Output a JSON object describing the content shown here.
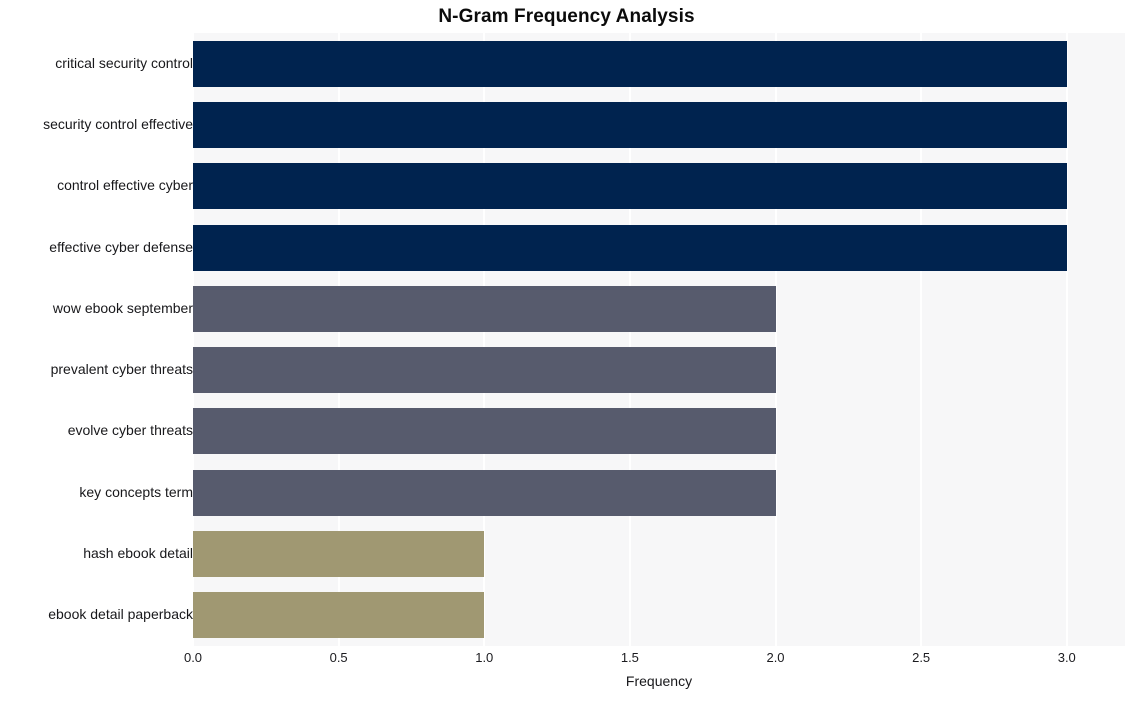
{
  "chart_data": {
    "type": "bar",
    "orientation": "horizontal",
    "title": "N-Gram Frequency Analysis",
    "xlabel": "Frequency",
    "ylabel": "",
    "categories": [
      "critical security control",
      "security control effective",
      "control effective cyber",
      "effective cyber defense",
      "wow ebook september",
      "prevalent cyber threats",
      "evolve cyber threats",
      "key concepts term",
      "hash ebook detail",
      "ebook detail paperback"
    ],
    "values": [
      3,
      3,
      3,
      3,
      2,
      2,
      2,
      2,
      1,
      1
    ],
    "bar_colors": [
      "#00234f",
      "#00234f",
      "#00234f",
      "#00234f",
      "#575b6d",
      "#575b6d",
      "#575b6d",
      "#575b6d",
      "#a09872",
      "#a09872"
    ],
    "xlim": [
      0.0,
      3.2
    ],
    "xticks": [
      "0.0",
      "0.5",
      "1.0",
      "1.5",
      "2.0",
      "2.5",
      "3.0"
    ],
    "xtick_values": [
      0.0,
      0.5,
      1.0,
      1.5,
      2.0,
      2.5,
      3.0
    ],
    "grid": "vertical",
    "grid_color": "#ffffff",
    "plot_background": "#f7f7f8",
    "figure_background": "#ffffff",
    "legend": null
  }
}
